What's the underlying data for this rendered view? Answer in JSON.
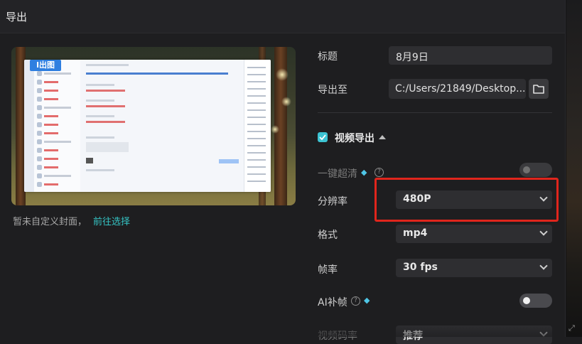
{
  "header": {
    "title": "导出"
  },
  "preview": {
    "logo_text": "I出图",
    "cover_note": "暂未自定义封面，",
    "cover_link": "前往选择"
  },
  "settings": {
    "title_label": "标题",
    "title_value": "8月9日",
    "export_to_label": "导出至",
    "export_path": "C:/Users/21849/Desktop...",
    "video_export_label": "视频导出",
    "video_export_checked": true,
    "enhance_label": "一键超清",
    "enhance_on": false,
    "resolution_label": "分辨率",
    "resolution_value": "480P",
    "format_label": "格式",
    "format_value": "mp4",
    "fps_label": "帧率",
    "fps_value": "30 fps",
    "ai_interp_label": "AI补帧",
    "ai_interp_on": false,
    "bitrate_label": "视频码率",
    "bitrate_value": "推荐"
  },
  "colors": {
    "accent": "#3cc3d2",
    "link": "#35c4c4",
    "highlight_box": "#e0251c",
    "background": "#1e1e20"
  },
  "icons": [
    "folder-icon",
    "checkbox-icon",
    "caret-up-icon",
    "diamond-icon",
    "question-icon",
    "chevron-down-icon"
  ]
}
